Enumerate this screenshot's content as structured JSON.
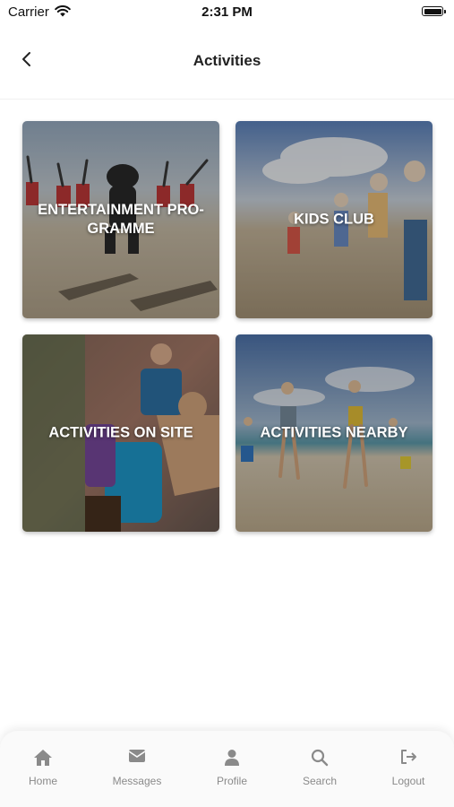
{
  "status_bar": {
    "carrier": "Carrier",
    "time": "2:31 PM"
  },
  "header": {
    "title": "Activities",
    "back_icon": "chevron-left-icon"
  },
  "tiles": [
    {
      "label": "ENTERTAINMENT PRO-\nGRAMME"
    },
    {
      "label": "KIDS CLUB"
    },
    {
      "label": "ACTIVITIES ON SITE"
    },
    {
      "label": "ACTIVITIES NEARBY"
    }
  ],
  "tab_bar": {
    "items": [
      {
        "label": "Home",
        "icon": "home-icon"
      },
      {
        "label": "Messages",
        "icon": "envelope-icon"
      },
      {
        "label": "Profile",
        "icon": "user-icon"
      },
      {
        "label": "Search",
        "icon": "search-icon"
      },
      {
        "label": "Logout",
        "icon": "logout-icon"
      }
    ]
  },
  "colors": {
    "text_primary": "#222222",
    "tab_inactive": "#8a8a8a",
    "tile_overlay_text": "#ffffff"
  }
}
